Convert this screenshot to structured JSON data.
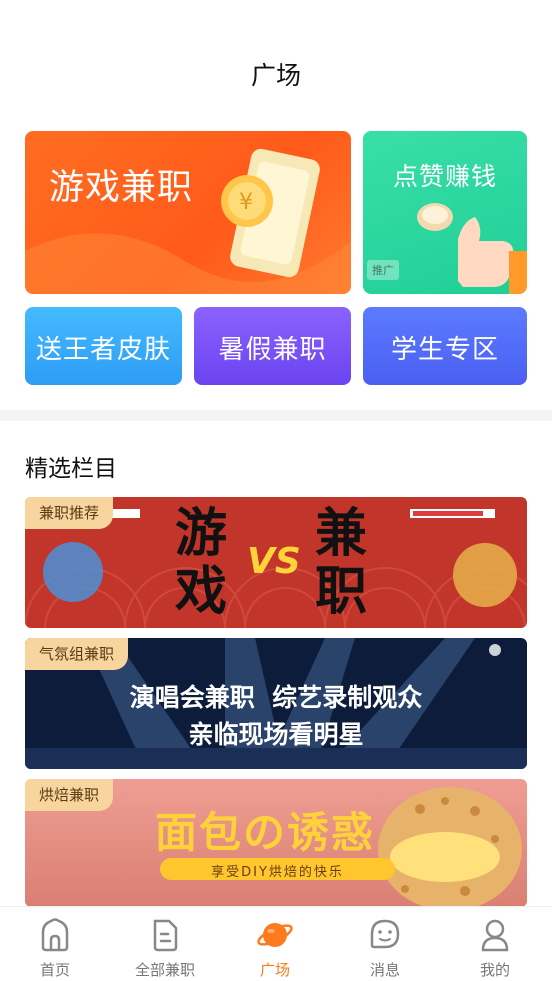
{
  "header": {
    "title": "广场"
  },
  "quick_cards": {
    "game": "游戏兼职",
    "like": "点赞赚钱",
    "promo_tag": "推广",
    "skin": "送王者皮肤",
    "summer": "暑假兼职",
    "student": "学生专区"
  },
  "section": {
    "title": "精选栏目"
  },
  "banners": [
    {
      "tag": "兼职推荐",
      "left_text": "游戏",
      "vs": "VS",
      "right_text": "兼职"
    },
    {
      "tag": "气氛组兼职",
      "line1": "演唱会兼职  综艺录制观众",
      "line2": "亲临现场看明星"
    },
    {
      "tag": "烘焙兼职",
      "headline": "面包の诱惑",
      "subline": "享受DIY烘焙的快乐"
    }
  ],
  "tabbar": {
    "items": [
      {
        "label": "首页",
        "icon": "home-icon"
      },
      {
        "label": "全部兼职",
        "icon": "document-icon"
      },
      {
        "label": "广场",
        "icon": "planet-icon",
        "active": true
      },
      {
        "label": "消息",
        "icon": "message-icon"
      },
      {
        "label": "我的",
        "icon": "profile-icon"
      }
    ]
  },
  "colors": {
    "accent": "#ff7a1a",
    "tab_inactive": "#777777"
  }
}
